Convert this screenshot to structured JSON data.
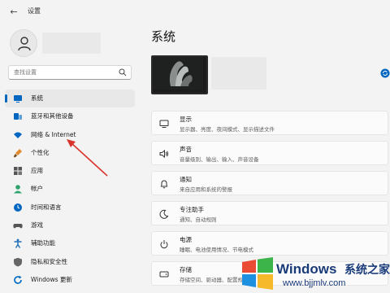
{
  "window": {
    "title": "设置",
    "back_icon": "back-arrow-icon"
  },
  "sidebar": {
    "search_placeholder": "查找设置",
    "items": [
      {
        "label": "系统",
        "icon": "monitor-icon",
        "color": "#0067c0",
        "active": true
      },
      {
        "label": "蓝牙和其他设备",
        "icon": "bluetooth-icon",
        "color": "#0067c0"
      },
      {
        "label": "网络 & Internet",
        "icon": "wifi-icon",
        "color": "#0067c0"
      },
      {
        "label": "个性化",
        "icon": "brush-icon",
        "color": "#e08b2f"
      },
      {
        "label": "应用",
        "icon": "apps-icon",
        "color": "#555555"
      },
      {
        "label": "帐户",
        "icon": "account-icon",
        "color": "#2ea36b"
      },
      {
        "label": "时间和语言",
        "icon": "globe-clock-icon",
        "color": "#0067c0"
      },
      {
        "label": "游戏",
        "icon": "gamepad-icon",
        "color": "#555555"
      },
      {
        "label": "辅助功能",
        "icon": "accessibility-icon",
        "color": "#1d6fb8"
      },
      {
        "label": "隐私和安全性",
        "icon": "shield-icon",
        "color": "#666666"
      },
      {
        "label": "Windows 更新",
        "icon": "update-icon",
        "color": "#0067c0"
      }
    ]
  },
  "main": {
    "title": "系统",
    "cards": [
      {
        "title": "显示",
        "desc": "显示器、亮度、夜间模式、显示描述文件",
        "icon": "display-icon"
      },
      {
        "title": "声音",
        "desc": "音量级别、输出、输入、声音设备",
        "icon": "speaker-icon"
      },
      {
        "title": "通知",
        "desc": "来自应用和系统的警报",
        "icon": "bell-icon"
      },
      {
        "title": "专注助手",
        "desc": "通知、自动规则",
        "icon": "moon-icon"
      },
      {
        "title": "电源",
        "desc": "睡眠、电池使用情况、节电模式",
        "icon": "power-icon"
      },
      {
        "title": "存储",
        "desc": "存储空间、驱动器、配置规则",
        "icon": "storage-icon"
      }
    ]
  },
  "watermark": {
    "brand": "Windows",
    "cn": "系统之家",
    "url": "www.bjjmlv.com"
  },
  "colors": {
    "accent": "#0067c0",
    "annotation_arrow": "#d9342b"
  }
}
